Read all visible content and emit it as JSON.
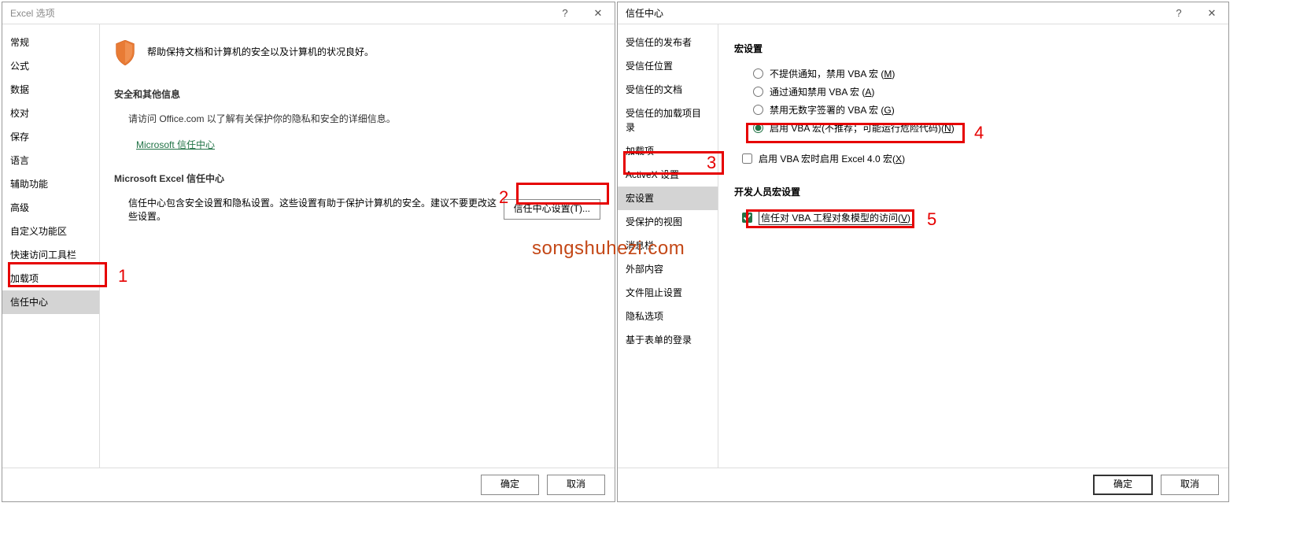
{
  "left_dialog": {
    "title": "Excel 选项",
    "help": "?",
    "close": "✕",
    "sidebar": [
      "常规",
      "公式",
      "数据",
      "校对",
      "保存",
      "语言",
      "辅助功能",
      "高级",
      "自定义功能区",
      "快速访问工具栏",
      "加载项",
      "信任中心"
    ],
    "selected_index": 11,
    "shield_text": "帮助保持文档和计算机的安全以及计算机的状况良好。",
    "sec1_title": "安全和其他信息",
    "sec1_text": "请访问 Office.com  以了解有关保护你的隐私和安全的详细信息。",
    "link": "Microsoft 信任中心",
    "sec2_title": "Microsoft Excel 信任中心",
    "sec2_text": "信任中心包含安全设置和隐私设置。这些设置有助于保护计算机的安全。建议不要更改这些设置。",
    "tc_btn": "信任中心设置(T)...",
    "ok": "确定",
    "cancel": "取消"
  },
  "right_dialog": {
    "title": "信任中心",
    "help": "?",
    "close": "✕",
    "sidebar": [
      "受信任的发布者",
      "受信任位置",
      "受信任的文档",
      "受信任的加载项目录",
      "加载项",
      "ActiveX 设置",
      "宏设置",
      "受保护的视图",
      "消息栏",
      "外部内容",
      "文件阻止设置",
      "隐私选项",
      "基于表单的登录"
    ],
    "selected_index": 6,
    "macro_heading": "宏设置",
    "radio1": "不提供通知，禁用 VBA 宏 (",
    "radio1_u": "M",
    "radio1_end": ")",
    "radio2": "通过通知禁用 VBA 宏 (",
    "radio2_u": "A",
    "radio2_end": ")",
    "radio3": "禁用无数字签署的 VBA 宏 (",
    "radio3_u": "G",
    "radio3_end": ")",
    "radio4": "启用 VBA 宏(不推荐；可能运行危险代码)(",
    "radio4_u": "N",
    "radio4_end": ")",
    "check1": "启用 VBA 宏时启用 Excel 4.0 宏(",
    "check1_u": "X",
    "check1_end": ")",
    "dev_heading": "开发人员宏设置",
    "check2": "信任对 VBA 工程对象模型的访问(",
    "check2_u": "V",
    "check2_end": ")",
    "ok": "确定",
    "cancel": "取消"
  },
  "annotations": {
    "a1": "1",
    "a2": "2",
    "a3": "3",
    "a4": "4",
    "a5": "5"
  },
  "watermark": "songshuhezi.com"
}
